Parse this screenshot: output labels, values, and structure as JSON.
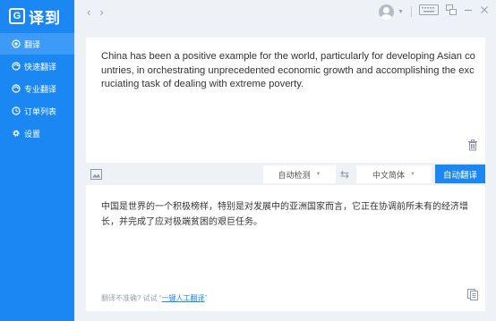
{
  "app": {
    "logo_mark": "G",
    "logo_text": "译到"
  },
  "sidebar": {
    "items": [
      {
        "label": "翻译",
        "icon": "circle-dot-icon",
        "active": true
      },
      {
        "label": "快速翻译",
        "icon": "refresh-circle-icon",
        "active": false
      },
      {
        "label": "专业翻译",
        "icon": "refresh-circle-icon",
        "active": false
      },
      {
        "label": "订单列表",
        "icon": "clock-icon",
        "active": false
      },
      {
        "label": "设置",
        "icon": "gear-icon",
        "active": false
      }
    ]
  },
  "topbar": {
    "back": "‹",
    "forward": "›",
    "dropdown_caret": "▼"
  },
  "source": {
    "text": "China has been a positive example for the world, particularly for developing  Asian countries, in orchestrating unprecedented economic growth and accomplishing the excruciating task of dealing with extreme poverty."
  },
  "toolbar": {
    "source_lang": "自动检测",
    "target_lang": "中文简体",
    "swap_symbol": "⇆",
    "translate_button": "自动翻译",
    "caret": "▼"
  },
  "result": {
    "text": "中国是世界的一个积极榜样，特别是对发展中的亚洲国家而言，它正在协调前所未有的经济增长，并完成了应对极端贫困的艰巨任务。",
    "feedback_prefix": "翻译不准确? 试试",
    "feedback_quote_open": " “",
    "feedback_link": "一键人工翻译",
    "feedback_quote_close": "”"
  },
  "colors": {
    "brand": "#1a87f3",
    "sidebar_active": "#3d9bf7",
    "background": "#eef1f6"
  }
}
